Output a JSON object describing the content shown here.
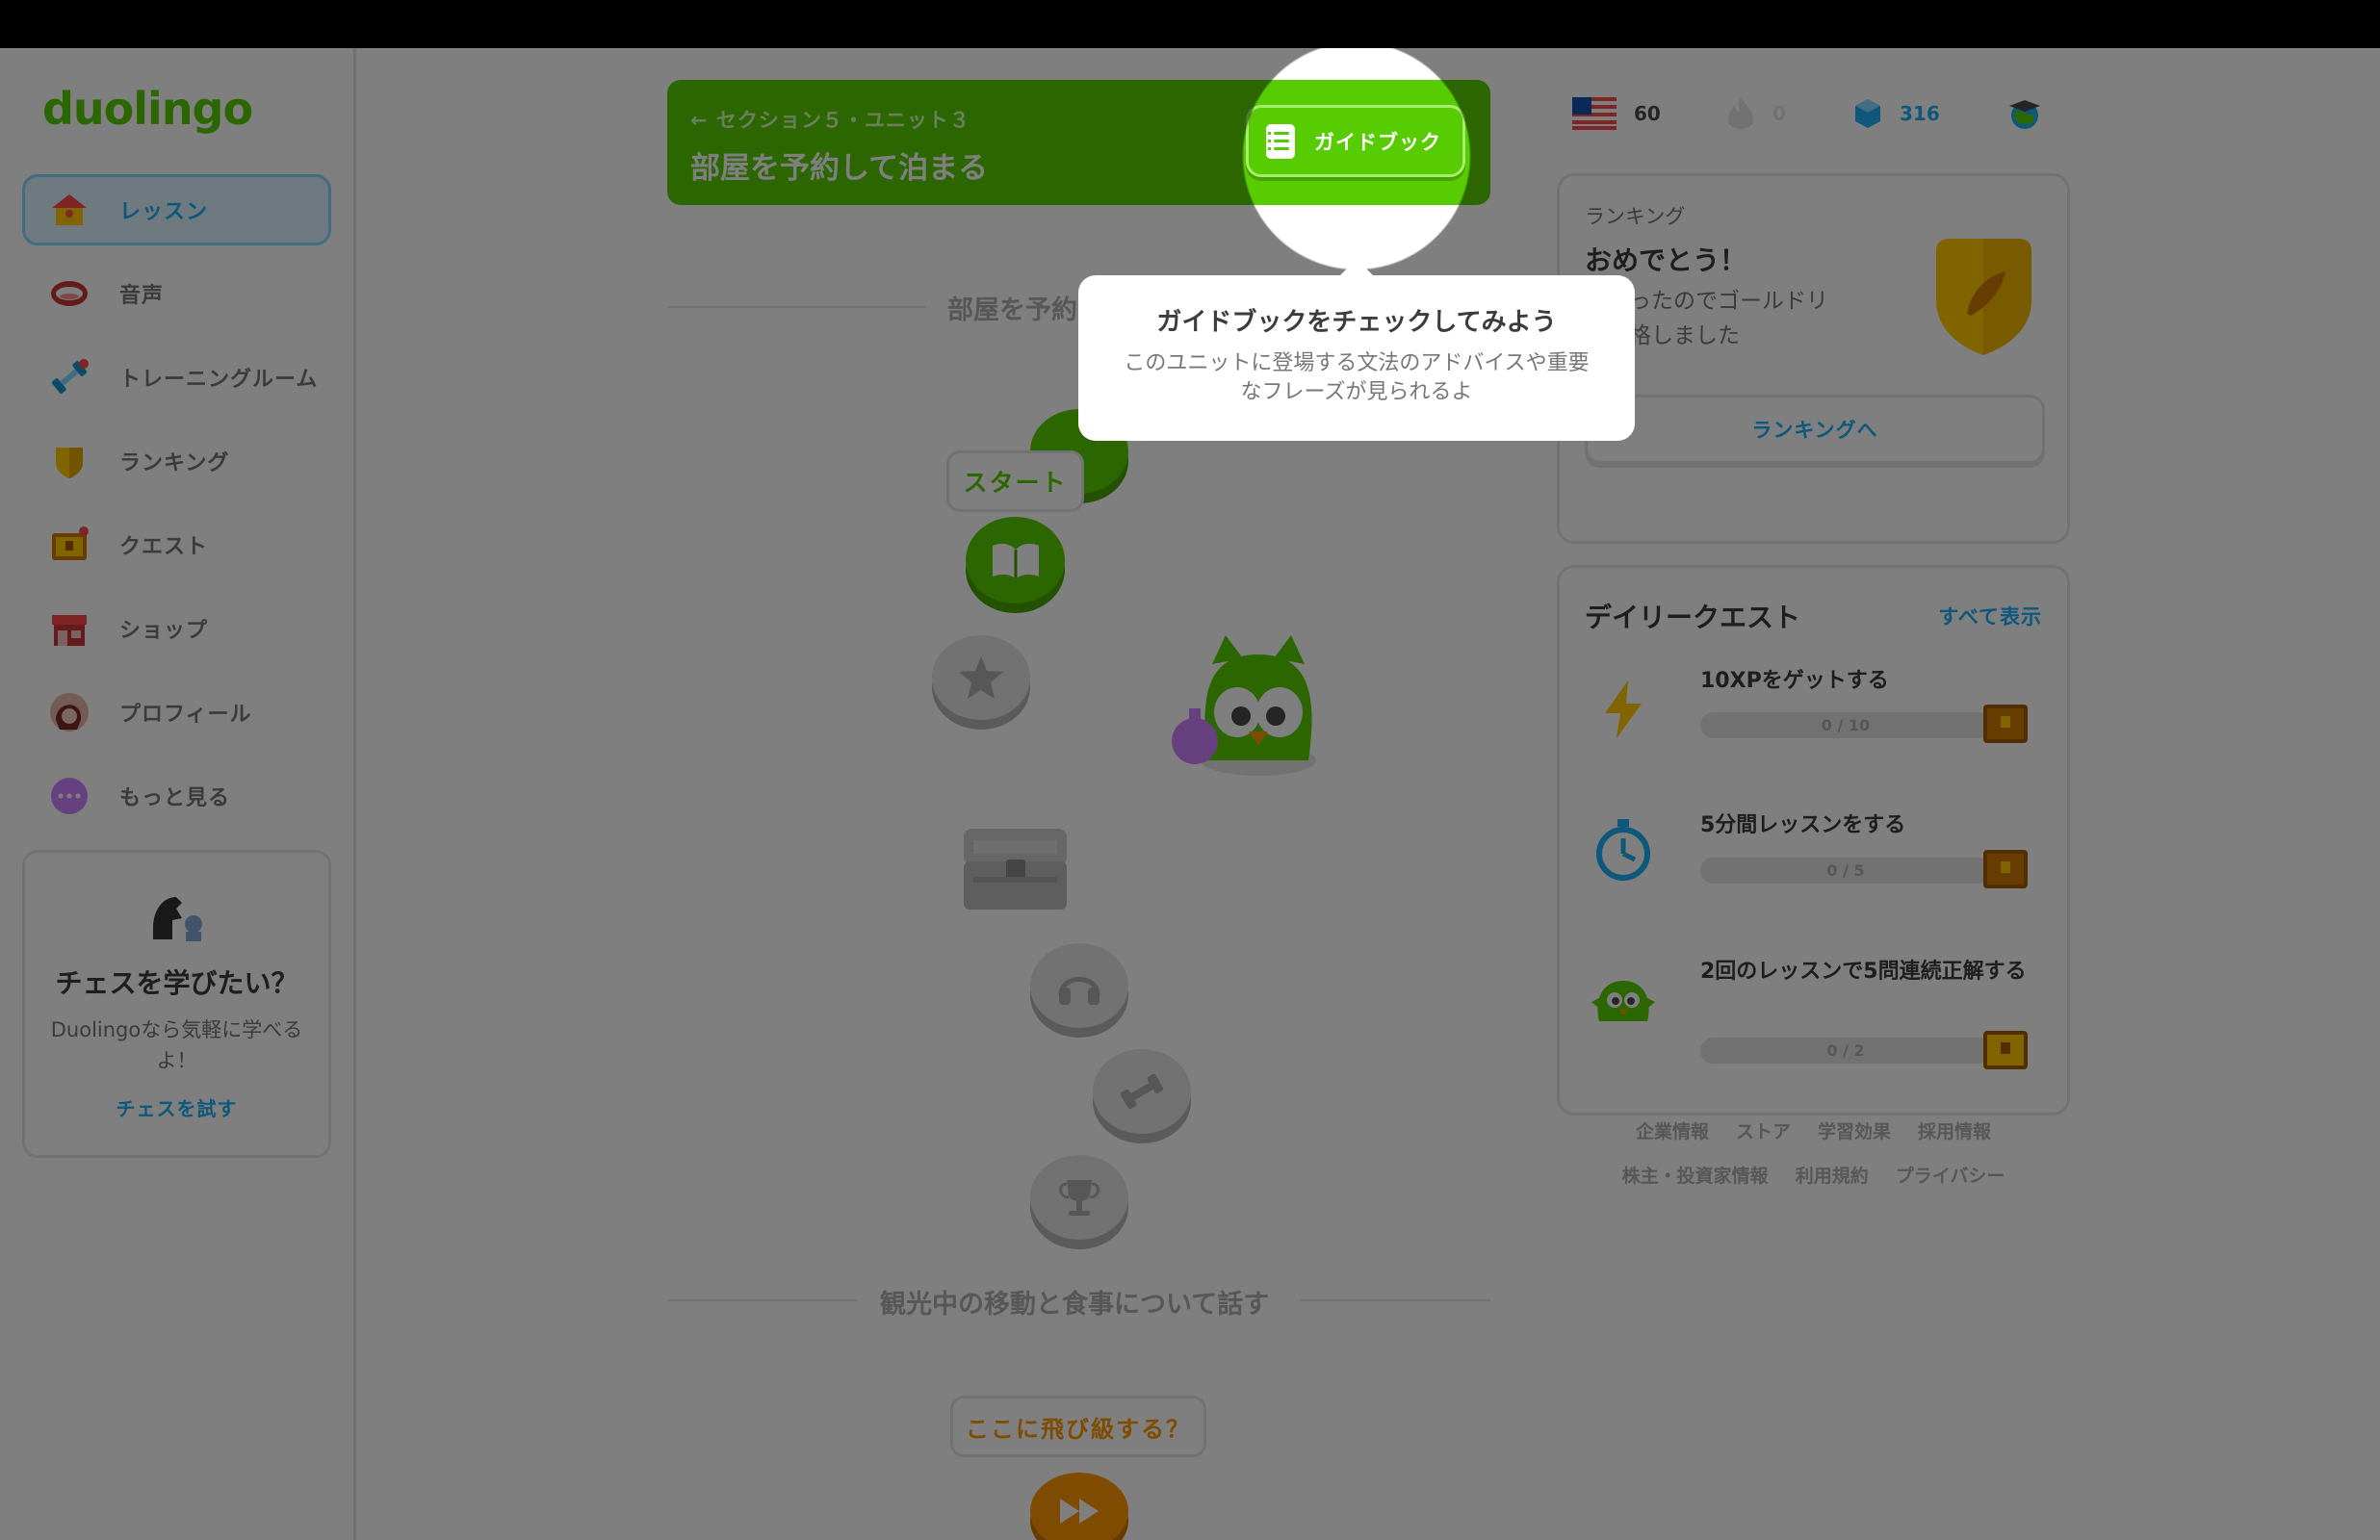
{
  "app": {
    "logo": "duolingo"
  },
  "sidebar": {
    "items": [
      {
        "label": "レッスン",
        "icon": "home-icon",
        "active": true
      },
      {
        "label": "音声",
        "icon": "mouth-icon"
      },
      {
        "label": "トレーニングルーム",
        "icon": "dumbbell-icon"
      },
      {
        "label": "ランキング",
        "icon": "shield-icon"
      },
      {
        "label": "クエスト",
        "icon": "chest-icon"
      },
      {
        "label": "ショップ",
        "icon": "shop-icon"
      },
      {
        "label": "プロフィール",
        "icon": "avatar-icon"
      },
      {
        "label": "もっと見る",
        "icon": "more-icon"
      }
    ],
    "promo": {
      "title": "チェスを学びたい？",
      "text": "Duolingoなら気軽に学べるよ！",
      "link": "チェスを試す"
    }
  },
  "unit": {
    "subtitle": "セクション５・ユニット３",
    "title": "部屋を予約して泊まる",
    "guidebook_label": "ガイドブック"
  },
  "path": {
    "section_title": "部屋を予約",
    "start_label": "スタート",
    "next_section_title": "観光中の移動と食事について話す",
    "skip_label": "ここに飛び級する？"
  },
  "stats": {
    "streak_flag": "US",
    "courses": "60",
    "streak": "0",
    "gems": "316"
  },
  "ranking": {
    "label": "ランキング",
    "title": "おめでとう！",
    "text_line1": "になったのでゴールドリ",
    "text_line2": "へ昇格しました",
    "button": "ランキングへ"
  },
  "quests": {
    "title": "デイリークエスト",
    "view_all": "すべて表示",
    "items": [
      {
        "title": "10XPをゲットする",
        "progress": "0 / 10",
        "icon": "lightning-icon"
      },
      {
        "title": "5分間レッスンをする",
        "progress": "0 / 5",
        "icon": "timer-icon"
      },
      {
        "title": "2回のレッスンで5問連続正解する",
        "progress": "0 / 2",
        "icon": "owl-icon"
      }
    ]
  },
  "footer": {
    "row1": [
      "企業情報",
      "ストア",
      "学習効果",
      "採用情報"
    ],
    "row2": [
      "株主・投資家情報",
      "利用規約",
      "プライバシー"
    ]
  },
  "tooltip": {
    "title": "ガイドブックをチェックしてみよう",
    "text": "このユニットに登場する文法のアドバイスや重要なフレーズが見られるよ"
  },
  "colors": {
    "brand": "#58cc02",
    "blue": "#1cb0f6",
    "orange": "#ff9600"
  }
}
